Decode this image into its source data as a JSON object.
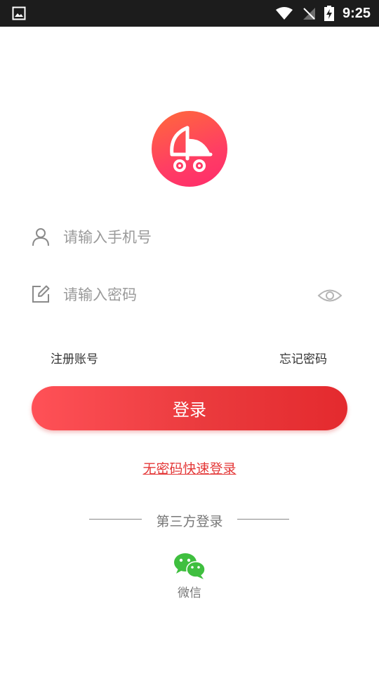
{
  "status_bar": {
    "time": "9:25",
    "icons": [
      "image-icon",
      "wifi-icon",
      "no-signal-icon",
      "battery-charging-icon"
    ]
  },
  "logo": {
    "icon": "umbrella-cart-logo",
    "colors": [
      "#ff6a3a",
      "#ff2b6c"
    ]
  },
  "form": {
    "phone": {
      "placeholder": "请输入手机号",
      "value": "",
      "icon": "user-icon"
    },
    "password": {
      "placeholder": "请输入密码",
      "value": "",
      "icon": "edit-icon",
      "toggle_icon": "eye-icon"
    }
  },
  "links": {
    "register": "注册账号",
    "forgot": "忘记密码"
  },
  "login_button": {
    "label": "登录",
    "color": "#e8353a"
  },
  "quick_login": {
    "label": "无密码快速登录",
    "color": "#e43838"
  },
  "third_party": {
    "title": "第三方登录",
    "providers": [
      {
        "label": "微信",
        "icon": "wechat-icon",
        "color": "#3fbf3f"
      }
    ]
  }
}
